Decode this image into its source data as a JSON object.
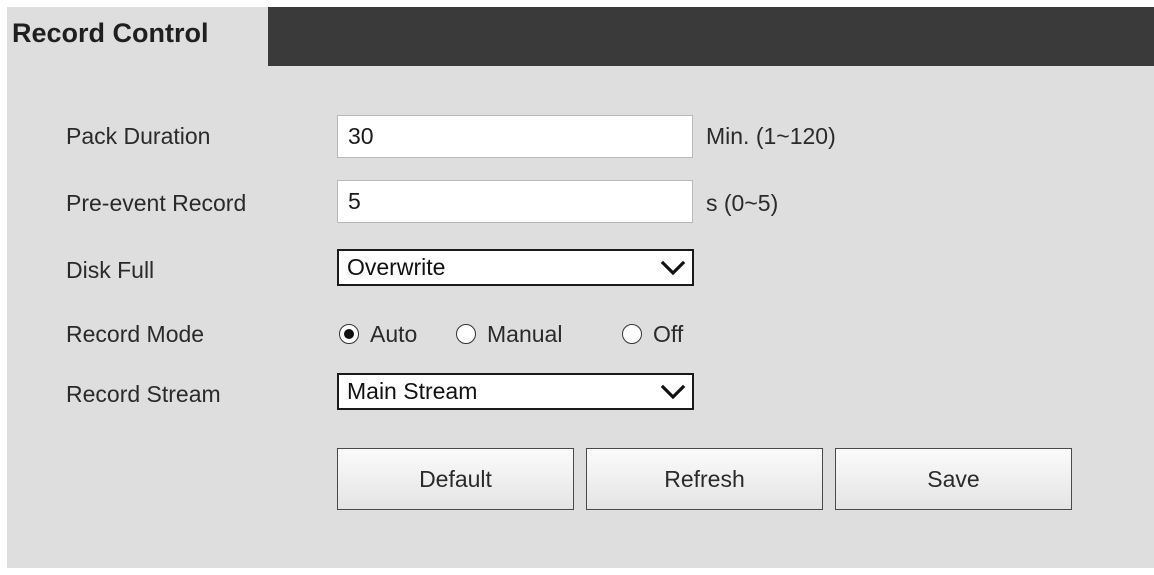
{
  "panel": {
    "title": "Record Control"
  },
  "form": {
    "pack_duration": {
      "label": "Pack Duration",
      "value": "30",
      "unit": "Min. (1~120)"
    },
    "pre_event_record": {
      "label": "Pre-event Record",
      "value": "5",
      "unit": "s (0~5)"
    },
    "disk_full": {
      "label": "Disk Full",
      "selected": "Overwrite"
    },
    "record_mode": {
      "label": "Record Mode",
      "options": [
        "Auto",
        "Manual",
        "Off"
      ],
      "selected": "Auto"
    },
    "record_stream": {
      "label": "Record Stream",
      "selected": "Main Stream"
    }
  },
  "buttons": {
    "default_label": "Default",
    "refresh_label": "Refresh",
    "save_label": "Save"
  },
  "icons": {
    "dropdown": "chevron-down-icon",
    "radio_selected": "radio-checked-icon",
    "radio_unselected": "radio-unchecked-icon"
  },
  "colors": {
    "panel_background": "#dedede",
    "title_bar": "#3a3a3a"
  }
}
